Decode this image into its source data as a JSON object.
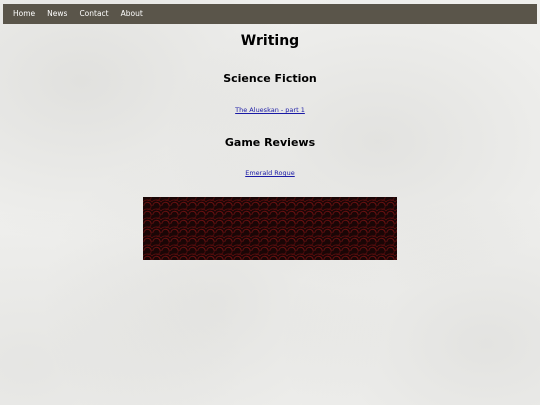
{
  "nav": {
    "items": [
      {
        "label": "Home"
      },
      {
        "label": "News"
      },
      {
        "label": "Contact"
      },
      {
        "label": "About"
      }
    ]
  },
  "page": {
    "title": "Writing"
  },
  "sections": [
    {
      "heading": "Science Fiction",
      "links": [
        {
          "label": "The Alueskan - part 1"
        }
      ]
    },
    {
      "heading": "Game Reviews",
      "links": [
        {
          "label": "Emerald Rogue"
        }
      ]
    }
  ],
  "banner": {
    "pattern": "red-scale-pattern",
    "colors": {
      "base": "#1a0606",
      "accent": "#7a1414"
    }
  },
  "colors": {
    "navbar": "#5a554a",
    "link": "#1a1aa6",
    "background": "#efefed"
  }
}
